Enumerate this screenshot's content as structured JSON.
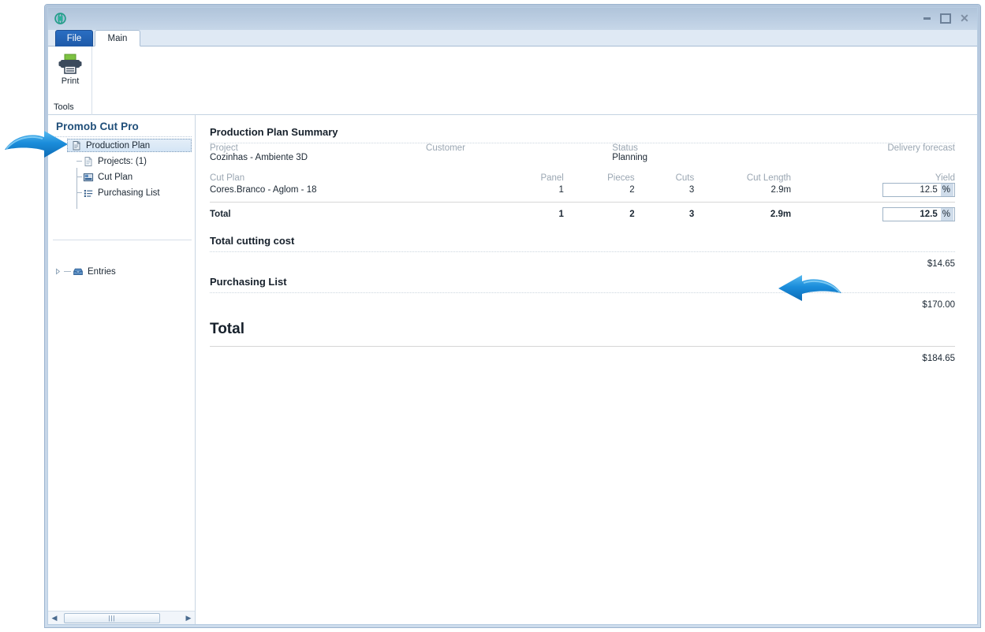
{
  "window": {
    "app_icon": "globe-icon",
    "controls": {
      "minimize": "minimize-icon",
      "maximize": "maximize-icon",
      "close": "close-icon"
    }
  },
  "ribbon": {
    "tabs": [
      {
        "id": "file",
        "label": "File",
        "active": false
      },
      {
        "id": "main",
        "label": "Main",
        "active": true
      }
    ],
    "group_label": "Tools",
    "print_button": {
      "label": "Print",
      "icon": "printer-icon"
    }
  },
  "sidebar": {
    "title": "Promob Cut Pro",
    "tree": [
      {
        "label": "Production Plan",
        "icon": "document-stack-icon",
        "level": 0,
        "selected": true
      },
      {
        "label": "Projects: (1)",
        "icon": "page-icon",
        "level": 1,
        "selected": false
      },
      {
        "label": "Cut Plan",
        "icon": "panel-layout-icon",
        "level": 1,
        "selected": false
      },
      {
        "label": "Purchasing List",
        "icon": "bullet-list-icon",
        "level": 1,
        "selected": false
      }
    ],
    "entries": {
      "label": "Entries",
      "icon": "inbox-icon",
      "expander": "chevron-right-icon"
    },
    "hscroll": {
      "left_arrow": "arrow-left-icon",
      "right_arrow": "arrow-right-icon",
      "grip": "|||"
    }
  },
  "content": {
    "summary_title": "Production Plan Summary",
    "project_headers": [
      "Project",
      "Customer",
      "Status",
      "Delivery forecast"
    ],
    "project_values": [
      "Cozinhas - Ambiente 3D",
      "",
      "Planning",
      ""
    ],
    "cutplan_headers": [
      "Cut Plan",
      "Panel",
      "Pieces",
      "Cuts",
      "Cut Length",
      "Yield"
    ],
    "cutplan_rows": [
      {
        "name": "Cores.Branco - Aglom - 18",
        "panel": "1",
        "pieces": "2",
        "cuts": "3",
        "cut_length": "2.9m",
        "yield_value": "12.5",
        "yield_unit": "%"
      }
    ],
    "cutplan_total": {
      "name": "Total",
      "panel": "1",
      "pieces": "2",
      "cuts": "3",
      "cut_length": "2.9m",
      "yield_value": "12.5",
      "yield_unit": "%"
    },
    "total_cutting_cost": {
      "label": "Total cutting cost",
      "amount": "$14.65"
    },
    "purchasing_list": {
      "label": "Purchasing List",
      "amount": "$170.00"
    },
    "grand_total": {
      "label": "Total",
      "amount": "$184.65"
    }
  },
  "annotations": [
    {
      "name": "arrow-pointing-production-plan",
      "direction": "right",
      "color": "#1a8fe0"
    },
    {
      "name": "arrow-pointing-cutting-cost",
      "direction": "left",
      "color": "#1a8fe0"
    }
  ]
}
